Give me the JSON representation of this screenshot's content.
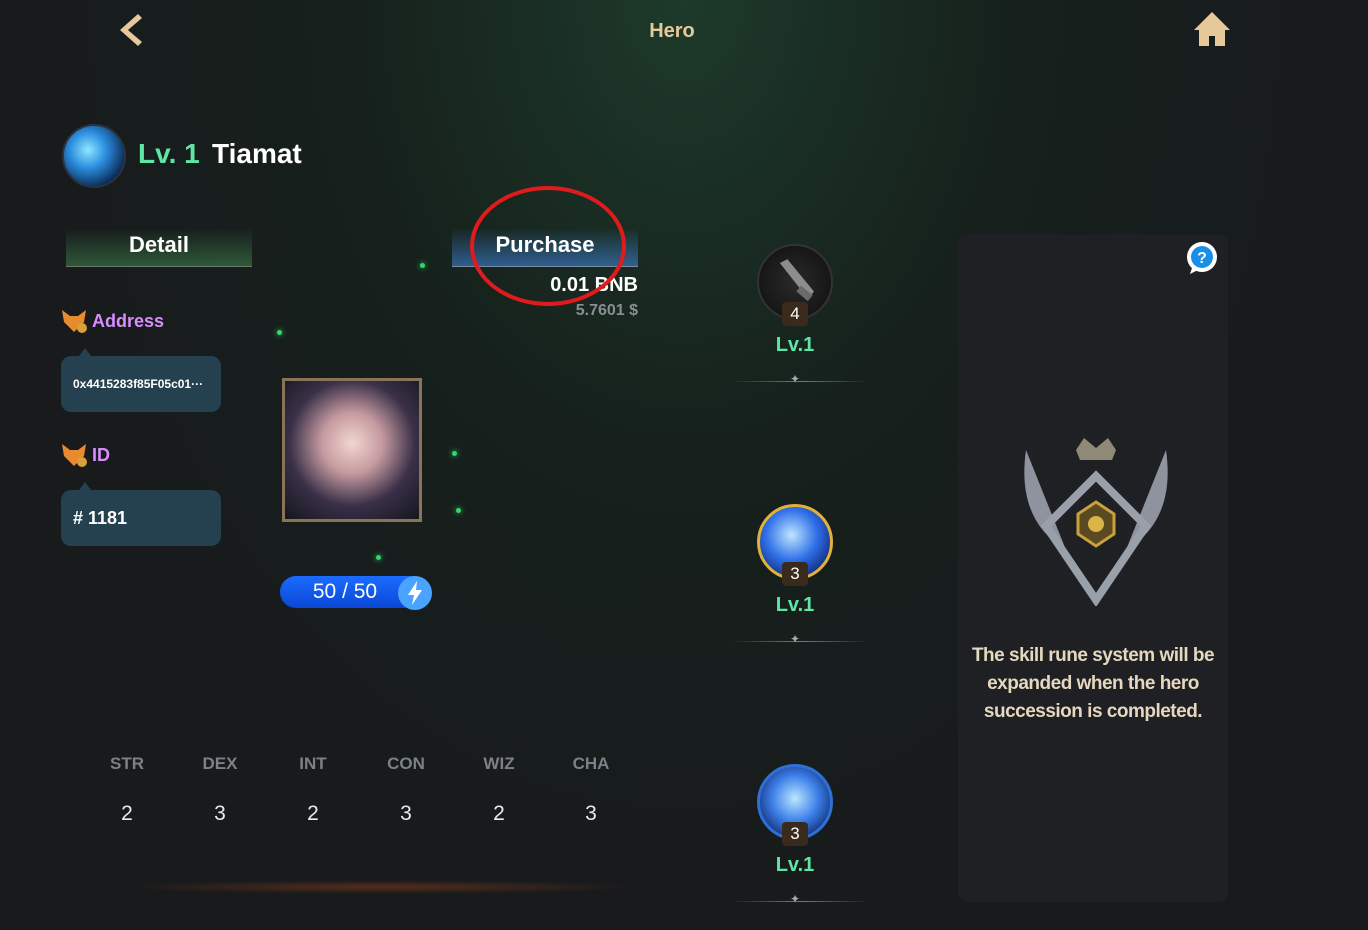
{
  "header": {
    "title": "Hero"
  },
  "hero": {
    "level": "Lv. 1",
    "name": "Tiamat"
  },
  "tabs": {
    "detail": "Detail",
    "purchase": "Purchase"
  },
  "price": {
    "bnb": "0.01 BNB",
    "usd": "5.7601 $"
  },
  "address": {
    "label": "Address",
    "value": "0x4415283f85F05c01···"
  },
  "id": {
    "label": "ID",
    "value": "# 1181"
  },
  "energy": {
    "text": "50 / 50",
    "current": 50,
    "max": 50
  },
  "stats": [
    {
      "label": "STR",
      "value": "2"
    },
    {
      "label": "DEX",
      "value": "3"
    },
    {
      "label": "INT",
      "value": "2"
    },
    {
      "label": "CON",
      "value": "3"
    },
    {
      "label": "WIZ",
      "value": "2"
    },
    {
      "label": "CHA",
      "value": "3"
    }
  ],
  "skills": [
    {
      "icon": "sword-icon",
      "count": "4",
      "level": "Lv.1"
    },
    {
      "icon": "blue-slash-icon",
      "count": "3",
      "level": "Lv.1"
    },
    {
      "icon": "water-orb-icon",
      "count": "3",
      "level": "Lv.1"
    }
  ],
  "rune_panel": {
    "message": "The skill rune system will be expanded when the hero succession is completed."
  },
  "colors": {
    "level_green": "#5fe6a5",
    "gold": "#e7c89a",
    "highlight_red": "#e01b1b",
    "address_purple": "#d78cff"
  }
}
